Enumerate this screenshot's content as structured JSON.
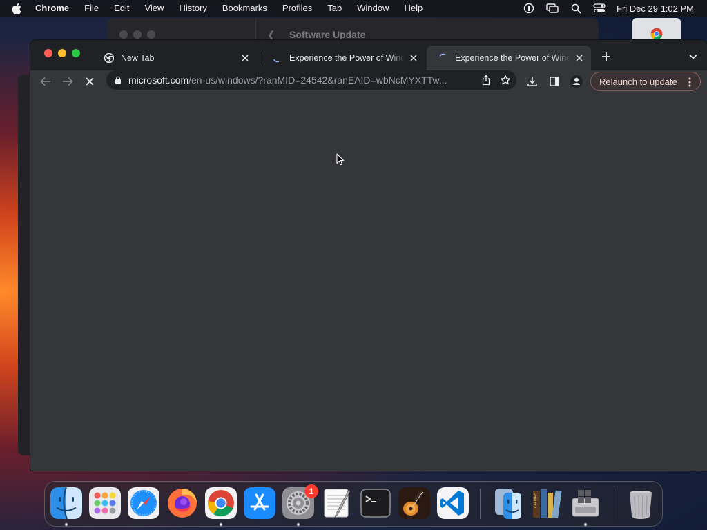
{
  "menubar": {
    "app_name": "Chrome",
    "items": [
      "File",
      "Edit",
      "View",
      "History",
      "Bookmarks",
      "Profiles",
      "Tab",
      "Window",
      "Help"
    ],
    "clock": "Fri Dec 29  1:02 PM",
    "status_icons": [
      "one-password-icon",
      "screen-mirroring-icon",
      "spotlight-search-icon",
      "control-center-icon"
    ]
  },
  "background_window": {
    "title": "Software Update"
  },
  "chrome": {
    "tabs": [
      {
        "title": "New Tab",
        "favicon": "chrome-icon",
        "active": false
      },
      {
        "title": "Experience the Power of Windows",
        "favicon": "loading-spinner-icon",
        "active": false
      },
      {
        "title": "Experience the Power of Windows",
        "favicon": "loading-spinner-icon",
        "active": true
      }
    ],
    "omnibox": {
      "url_host": "microsoft.com",
      "url_path": "/en-us/windows/?ranMID=24542&ranEAID=wbNcMYXTTw..."
    },
    "relaunch_label": "Relaunch to update"
  },
  "dock": {
    "apps": [
      "Finder",
      "Launchpad",
      "Safari",
      "Firefox",
      "Google Chrome",
      "App Store",
      "System Preferences",
      "TextEdit",
      "Terminal",
      "GarageBand",
      "Visual Studio Code",
      "Migration Assistant",
      "Calibre",
      "Boot Camp Assistant",
      "Trash"
    ],
    "system_preferences_badge": "1"
  },
  "colors": {
    "page_bg": "#35363a",
    "tabstrip_bg": "#202124",
    "relaunch_border": "#8e5f58"
  }
}
